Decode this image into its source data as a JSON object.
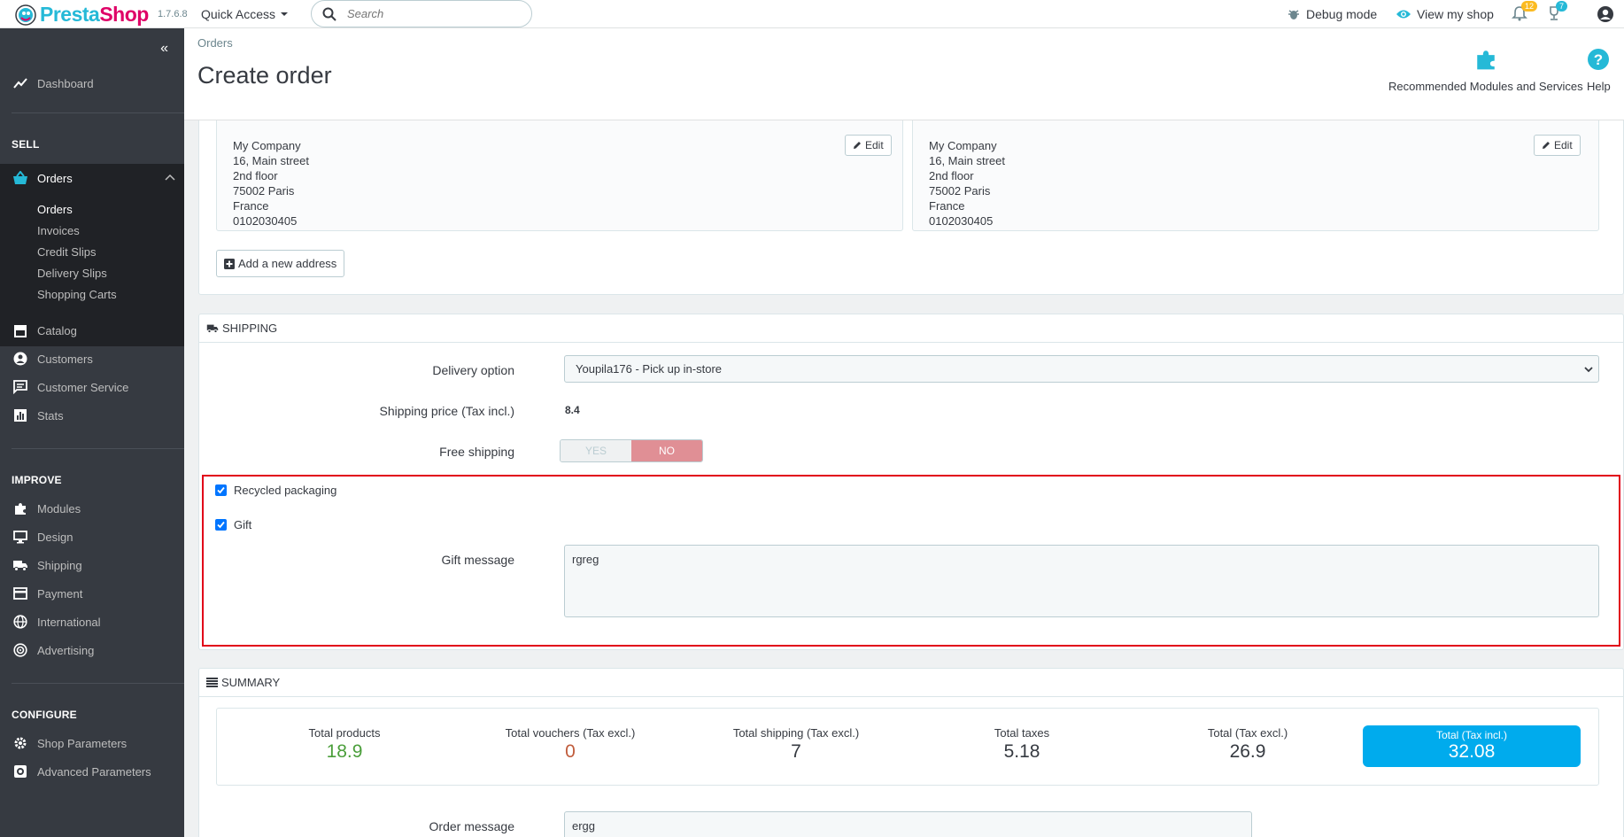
{
  "header": {
    "logo_pre": "Presta",
    "logo_shop": "Shop",
    "version": "1.7.6.8",
    "quick_access": "Quick Access",
    "search_placeholder": "Search",
    "debug_mode": "Debug mode",
    "view_shop": "View my shop",
    "notifications_count": "12",
    "trophy_count": "7"
  },
  "sidebar": {
    "dashboard": "Dashboard",
    "sell_title": "SELL",
    "orders": "Orders",
    "orders_sub": [
      "Orders",
      "Invoices",
      "Credit Slips",
      "Delivery Slips",
      "Shopping Carts"
    ],
    "catalog": "Catalog",
    "customers": "Customers",
    "customer_service": "Customer Service",
    "stats": "Stats",
    "improve_title": "IMPROVE",
    "modules": "Modules",
    "design": "Design",
    "shipping": "Shipping",
    "payment": "Payment",
    "international": "International",
    "advertising": "Advertising",
    "configure_title": "CONFIGURE",
    "shop_parameters": "Shop Parameters",
    "advanced_parameters": "Advanced Parameters"
  },
  "pagehead": {
    "breadcrumb": "Orders",
    "title": "Create order",
    "recommended": "Recommended Modules and Services",
    "help": "Help"
  },
  "addresses": {
    "left": [
      "My Company",
      "16, Main street",
      "2nd floor",
      "75002 Paris",
      "France",
      "0102030405"
    ],
    "right": [
      "My Company",
      "16, Main street",
      "2nd floor",
      "75002 Paris",
      "France",
      "0102030405"
    ],
    "edit_label": "Edit",
    "add_new": "Add a new address"
  },
  "shipping": {
    "title": "SHIPPING",
    "delivery_option_label": "Delivery option",
    "delivery_option_value": "Youpila176 - Pick up in-store",
    "shipping_price_label": "Shipping price (Tax incl.)",
    "shipping_price_value": "8.4",
    "free_shipping_label": "Free shipping",
    "yes": "YES",
    "no": "NO",
    "recycled_label": "Recycled packaging",
    "gift_label": "Gift",
    "gift_message_label": "Gift message",
    "gift_message_value": "rgreg"
  },
  "summary": {
    "title": "SUMMARY",
    "total_products_label": "Total products",
    "total_products": "18.9",
    "total_vouchers_label": "Total vouchers (Tax excl.)",
    "total_vouchers": "0",
    "total_shipping_label": "Total shipping (Tax excl.)",
    "total_shipping": "7",
    "total_taxes_label": "Total taxes",
    "total_taxes": "5.18",
    "total_tax_excl_label": "Total (Tax excl.)",
    "total_tax_excl": "26.9",
    "total_tax_incl_label": "Total (Tax incl.)",
    "total_tax_incl": "32.08",
    "order_message_label": "Order message",
    "order_message_value": "ergg"
  },
  "colors": {
    "brand": "#25b9d7",
    "sidebar_bg": "#363a41",
    "danger": "#e10019",
    "success": "#4cbb6c"
  }
}
